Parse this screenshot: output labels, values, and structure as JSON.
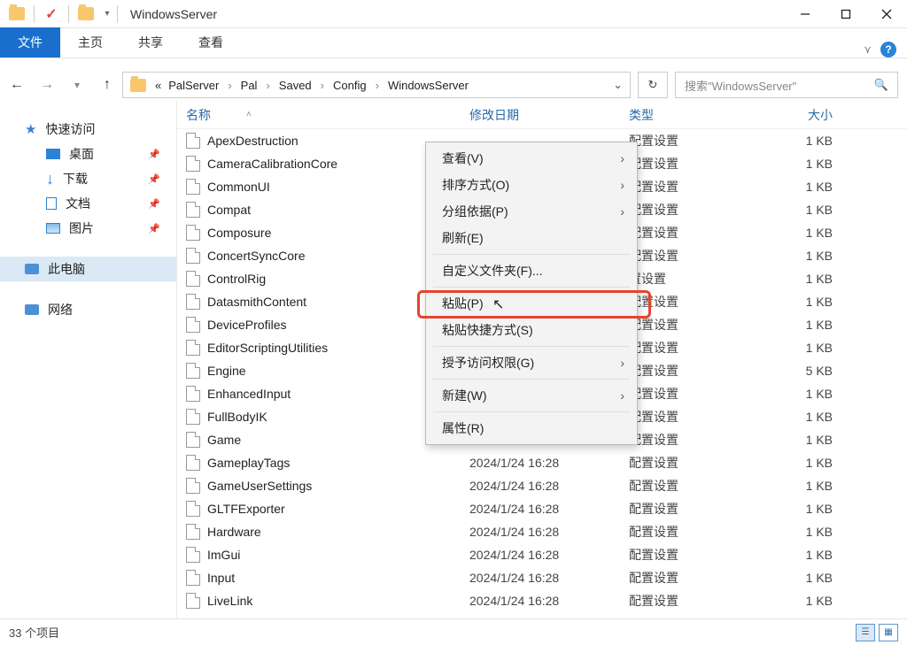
{
  "titlebar": {
    "title": "WindowsServer"
  },
  "tabs": {
    "file": "文件",
    "home": "主页",
    "share": "共享",
    "view": "查看"
  },
  "breadcrumb": [
    "PalServer",
    "Pal",
    "Saved",
    "Config",
    "WindowsServer"
  ],
  "search": {
    "placeholder": "搜索\"WindowsServer\""
  },
  "sidebar": {
    "quick_access": "快速访问",
    "desktop": "桌面",
    "downloads": "下载",
    "documents": "文档",
    "pictures": "图片",
    "this_pc": "此电脑",
    "network": "网络"
  },
  "columns": {
    "name": "名称",
    "date": "修改日期",
    "type": "类型",
    "size": "大小"
  },
  "files": [
    {
      "name": "ApexDestruction",
      "type": "配置设置",
      "size": "1 KB"
    },
    {
      "name": "CameraCalibrationCore",
      "type": "配置设置",
      "size": "1 KB"
    },
    {
      "name": "CommonUI",
      "type": "配置设置",
      "size": "1 KB"
    },
    {
      "name": "Compat",
      "type": "配置设置",
      "size": "1 KB"
    },
    {
      "name": "Composure",
      "type": "配置设置",
      "size": "1 KB"
    },
    {
      "name": "ConcertSyncCore",
      "type": "配置设置",
      "size": "1 KB"
    },
    {
      "name": "ControlRig",
      "type": "置设置",
      "size": "1 KB"
    },
    {
      "name": "DatasmithContent",
      "type": "配置设置",
      "size": "1 KB"
    },
    {
      "name": "DeviceProfiles",
      "type": "配置设置",
      "size": "1 KB"
    },
    {
      "name": "EditorScriptingUtilities",
      "type": "配置设置",
      "size": "1 KB"
    },
    {
      "name": "Engine",
      "type": "配置设置",
      "size": "5 KB"
    },
    {
      "name": "EnhancedInput",
      "type": "配置设置",
      "size": "1 KB"
    },
    {
      "name": "FullBodyIK",
      "type": "配置设置",
      "size": "1 KB"
    },
    {
      "name": "Game",
      "date": "2024/1/24 16:28",
      "type": "配置设置",
      "size": "1 KB"
    },
    {
      "name": "GameplayTags",
      "date": "2024/1/24 16:28",
      "type": "配置设置",
      "size": "1 KB"
    },
    {
      "name": "GameUserSettings",
      "date": "2024/1/24 16:28",
      "type": "配置设置",
      "size": "1 KB"
    },
    {
      "name": "GLTFExporter",
      "date": "2024/1/24 16:28",
      "type": "配置设置",
      "size": "1 KB"
    },
    {
      "name": "Hardware",
      "date": "2024/1/24 16:28",
      "type": "配置设置",
      "size": "1 KB"
    },
    {
      "name": "ImGui",
      "date": "2024/1/24 16:28",
      "type": "配置设置",
      "size": "1 KB"
    },
    {
      "name": "Input",
      "date": "2024/1/24 16:28",
      "type": "配置设置",
      "size": "1 KB"
    },
    {
      "name": "LiveLink",
      "date": "2024/1/24 16:28",
      "type": "配置设置",
      "size": "1 KB"
    }
  ],
  "context_menu": {
    "view": "查看(V)",
    "sort": "排序方式(O)",
    "group": "分组依据(P)",
    "refresh": "刷新(E)",
    "customize": "自定义文件夹(F)...",
    "paste": "粘贴(P)",
    "paste_shortcut": "粘贴快捷方式(S)",
    "grant_access": "授予访问权限(G)",
    "new": "新建(W)",
    "properties": "属性(R)"
  },
  "statusbar": {
    "count_label": "33 个项目"
  }
}
